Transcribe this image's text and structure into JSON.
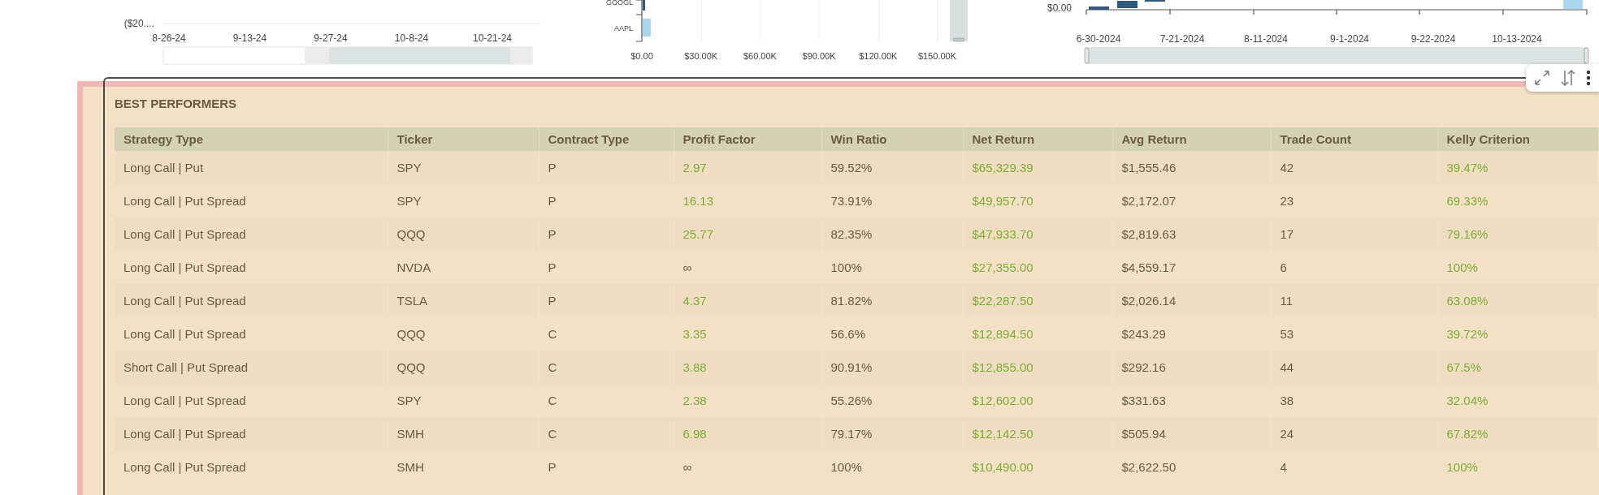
{
  "charts": [
    {
      "kind": "line",
      "y_labels": [
        "($20...."
      ],
      "x_labels": [
        "8-26-24",
        "9-13-24",
        "9-27-24",
        "10-8-24",
        "10-21-24"
      ]
    },
    {
      "kind": "hbar",
      "y_labels": [
        "GOOGL",
        "AAPL"
      ],
      "x_labels": [
        "$0.00",
        "$30.00K",
        "$60.00K",
        "$90.00K",
        "$120.00K",
        "$150.00K"
      ]
    },
    {
      "kind": "vbar",
      "y_labels": [
        "$0.00"
      ],
      "x_labels": [
        "6-30-2024",
        "7-21-2024",
        "8-11-2024",
        "9-1-2024",
        "9-22-2024",
        "10-13-2024"
      ]
    }
  ],
  "panel": {
    "title": "BEST PERFORMERS",
    "columns": [
      "Strategy Type",
      "Ticker",
      "Contract Type",
      "Profit Factor",
      "Win Ratio",
      "Net Return",
      "Avg Return",
      "Trade Count",
      "Kelly Criterion"
    ],
    "rows": [
      [
        {
          "text": "Long Call | Put",
          "positive": false
        },
        {
          "text": "SPY",
          "positive": false
        },
        {
          "text": "P",
          "positive": false
        },
        {
          "text": "2.97",
          "positive": true
        },
        {
          "text": "59.52%",
          "positive": false
        },
        {
          "text": "$65,329.39",
          "positive": true
        },
        {
          "text": "$1,555.46",
          "positive": false
        },
        {
          "text": "42",
          "positive": false
        },
        {
          "text": "39.47%",
          "positive": true
        }
      ],
      [
        {
          "text": "Long Call | Put Spread",
          "positive": false
        },
        {
          "text": "SPY",
          "positive": false
        },
        {
          "text": "P",
          "positive": false
        },
        {
          "text": "16.13",
          "positive": true
        },
        {
          "text": "73.91%",
          "positive": false
        },
        {
          "text": "$49,957.70",
          "positive": true
        },
        {
          "text": "$2,172.07",
          "positive": false
        },
        {
          "text": "23",
          "positive": false
        },
        {
          "text": "69.33%",
          "positive": true
        }
      ],
      [
        {
          "text": "Long Call | Put Spread",
          "positive": false
        },
        {
          "text": "QQQ",
          "positive": false
        },
        {
          "text": "P",
          "positive": false
        },
        {
          "text": "25.77",
          "positive": true
        },
        {
          "text": "82.35%",
          "positive": false
        },
        {
          "text": "$47,933.70",
          "positive": true
        },
        {
          "text": "$2,819.63",
          "positive": false
        },
        {
          "text": "17",
          "positive": false
        },
        {
          "text": "79.16%",
          "positive": true
        }
      ],
      [
        {
          "text": "Long Call | Put Spread",
          "positive": false
        },
        {
          "text": "NVDA",
          "positive": false
        },
        {
          "text": "P",
          "positive": false
        },
        {
          "text": "∞",
          "positive": false
        },
        {
          "text": "100%",
          "positive": false
        },
        {
          "text": "$27,355.00",
          "positive": true
        },
        {
          "text": "$4,559.17",
          "positive": false
        },
        {
          "text": "6",
          "positive": false
        },
        {
          "text": "100%",
          "positive": true
        }
      ],
      [
        {
          "text": "Long Call | Put Spread",
          "positive": false
        },
        {
          "text": "TSLA",
          "positive": false
        },
        {
          "text": "P",
          "positive": false
        },
        {
          "text": "4.37",
          "positive": true
        },
        {
          "text": "81.82%",
          "positive": false
        },
        {
          "text": "$22,287.50",
          "positive": true
        },
        {
          "text": "$2,026.14",
          "positive": false
        },
        {
          "text": "11",
          "positive": false
        },
        {
          "text": "63.08%",
          "positive": true
        }
      ],
      [
        {
          "text": "Long Call | Put Spread",
          "positive": false
        },
        {
          "text": "QQQ",
          "positive": false
        },
        {
          "text": "C",
          "positive": false
        },
        {
          "text": "3.35",
          "positive": true
        },
        {
          "text": "56.6%",
          "positive": false
        },
        {
          "text": "$12,894.50",
          "positive": true
        },
        {
          "text": "$243.29",
          "positive": false
        },
        {
          "text": "53",
          "positive": false
        },
        {
          "text": "39.72%",
          "positive": true
        }
      ],
      [
        {
          "text": "Short Call | Put Spread",
          "positive": false
        },
        {
          "text": "QQQ",
          "positive": false
        },
        {
          "text": "C",
          "positive": false
        },
        {
          "text": "3.88",
          "positive": true
        },
        {
          "text": "90.91%",
          "positive": false
        },
        {
          "text": "$12,855.00",
          "positive": true
        },
        {
          "text": "$292.16",
          "positive": false
        },
        {
          "text": "44",
          "positive": false
        },
        {
          "text": "67.5%",
          "positive": true
        }
      ],
      [
        {
          "text": "Long Call | Put Spread",
          "positive": false
        },
        {
          "text": "SPY",
          "positive": false
        },
        {
          "text": "C",
          "positive": false
        },
        {
          "text": "2.38",
          "positive": true
        },
        {
          "text": "55.26%",
          "positive": false
        },
        {
          "text": "$12,602.00",
          "positive": true
        },
        {
          "text": "$331.63",
          "positive": false
        },
        {
          "text": "38",
          "positive": false
        },
        {
          "text": "32.04%",
          "positive": true
        }
      ],
      [
        {
          "text": "Long Call | Put Spread",
          "positive": false
        },
        {
          "text": "SMH",
          "positive": false
        },
        {
          "text": "C",
          "positive": false
        },
        {
          "text": "6.98",
          "positive": true
        },
        {
          "text": "79.17%",
          "positive": false
        },
        {
          "text": "$12,142.50",
          "positive": true
        },
        {
          "text": "$505.94",
          "positive": false
        },
        {
          "text": "24",
          "positive": false
        },
        {
          "text": "67.82%",
          "positive": true
        }
      ],
      [
        {
          "text": "Long Call | Put Spread",
          "positive": false
        },
        {
          "text": "SMH",
          "positive": false
        },
        {
          "text": "P",
          "positive": false
        },
        {
          "text": "∞",
          "positive": false
        },
        {
          "text": "100%",
          "positive": false
        },
        {
          "text": "$10,490.00",
          "positive": true
        },
        {
          "text": "$2,622.50",
          "positive": false
        },
        {
          "text": "4",
          "positive": false
        },
        {
          "text": "100%",
          "positive": true
        }
      ]
    ]
  }
}
